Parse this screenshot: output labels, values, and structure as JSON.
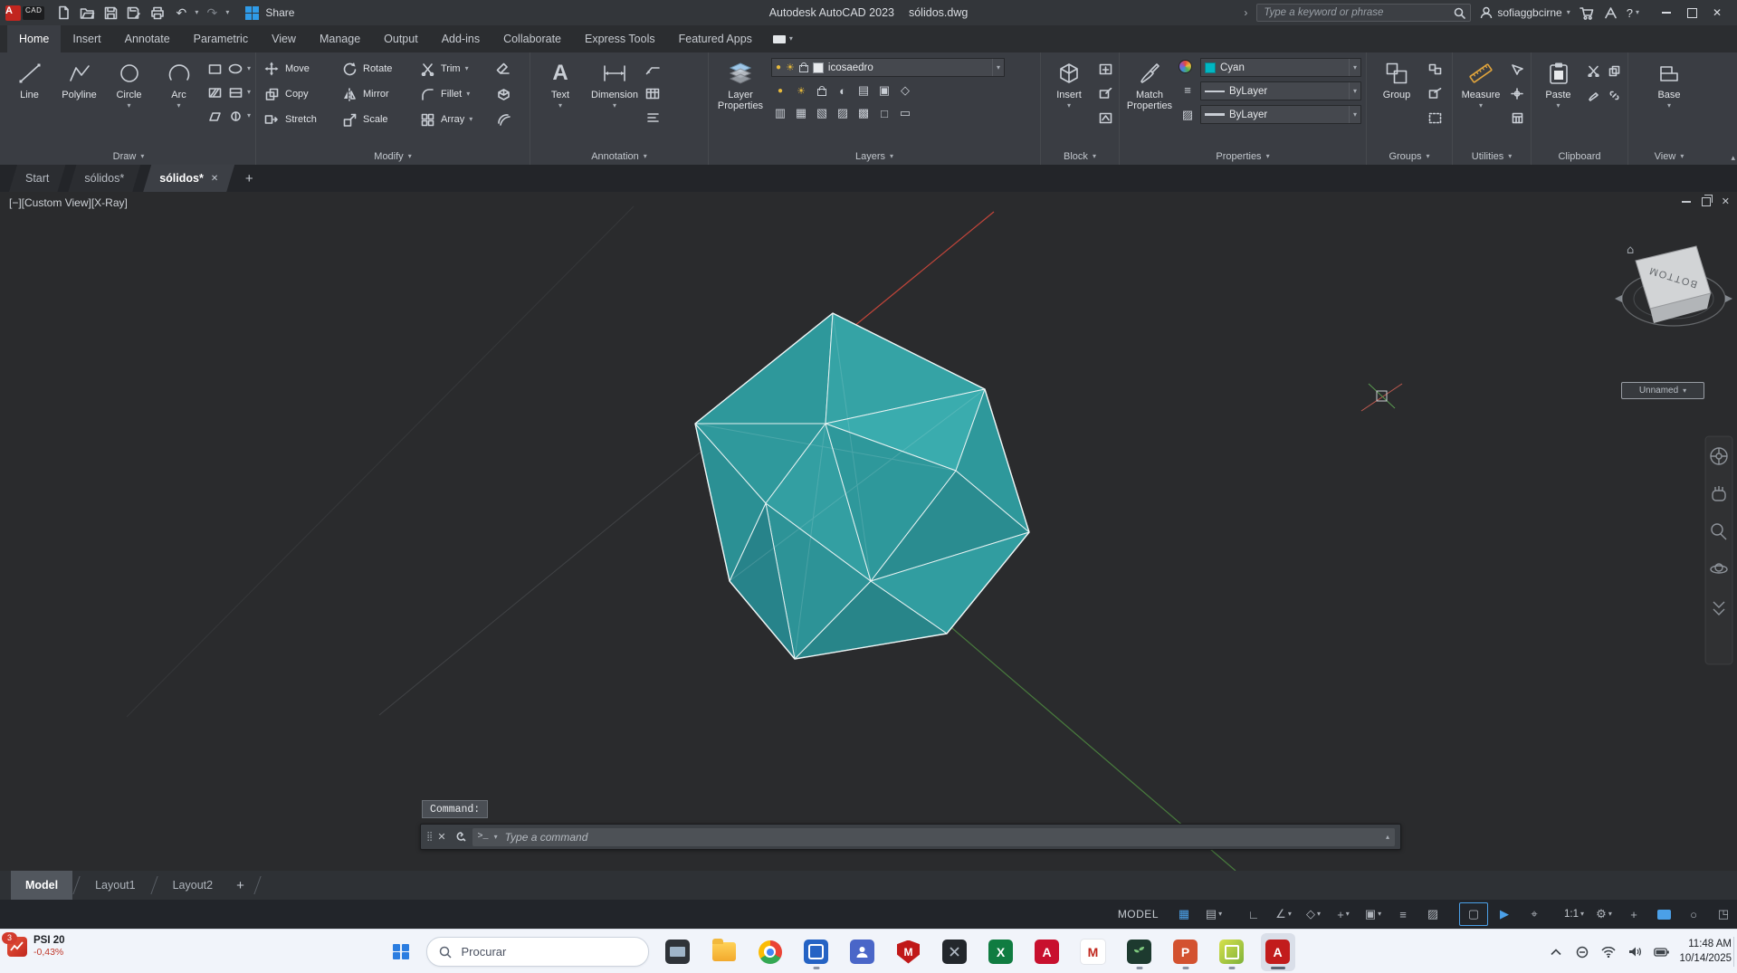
{
  "window": {
    "app_name": "Autodesk AutoCAD 2023",
    "doc_name": "sólidos.dwg",
    "share_label": "Share",
    "search_placeholder": "Type a keyword or phrase",
    "user_name": "sofiaggbcirne",
    "help_label": "?",
    "logo_a": "A",
    "logo_cad": "CAD"
  },
  "glyphs": {
    "down": "▾",
    "close": "✕",
    "plus": "+",
    "undo": "↶",
    "redo": "↷",
    "grip": "⣿",
    "caret_up": "▴",
    "chev_right": "›",
    "home": "⌂",
    "asterisk_a": "A"
  },
  "ribbon": {
    "tabs": [
      "Home",
      "Insert",
      "Annotate",
      "Parametric",
      "View",
      "Manage",
      "Output",
      "Add-ins",
      "Collaborate",
      "Express Tools",
      "Featured Apps"
    ],
    "active_tab": "Home",
    "draw": {
      "label": "Draw",
      "line": "Line",
      "polyline": "Polyline",
      "circle": "Circle",
      "arc": "Arc"
    },
    "modify": {
      "label": "Modify",
      "move": "Move",
      "rotate": "Rotate",
      "trim": "Trim",
      "copy": "Copy",
      "mirror": "Mirror",
      "fillet": "Fillet",
      "stretch": "Stretch",
      "scale": "Scale",
      "array": "Array"
    },
    "annotation": {
      "label": "Annotation",
      "text": "Text",
      "dimension": "Dimension"
    },
    "layers": {
      "label": "Layers",
      "main": "Layer Properties",
      "layer_name": "icosaedro"
    },
    "block": {
      "label": "Block",
      "main": "Insert"
    },
    "properties": {
      "label": "Properties",
      "main": "Match Properties",
      "color": "Cyan",
      "linetype": "ByLayer",
      "lineweight": "ByLayer"
    },
    "groups": {
      "label": "Groups",
      "main": "Group"
    },
    "utilities": {
      "label": "Utilities",
      "main": "Measure"
    },
    "clipboard": {
      "label": "Clipboard",
      "main": "Paste"
    },
    "view": {
      "label": "View",
      "main": "Base"
    }
  },
  "file_tabs": {
    "start": "Start",
    "tab1": "sólidos*",
    "tab2": "sólidos*"
  },
  "viewport": {
    "controls_label": "[−][Custom View][X-Ray]",
    "viewcube_face": "BOTTOM",
    "view_name": "Unnamed",
    "command_echo": "Command:",
    "command_prompt_icon": ">_",
    "command_placeholder": "Type a command"
  },
  "layout_tabs": {
    "model": "Model",
    "layout1": "Layout1",
    "layout2": "Layout2"
  },
  "status_bar": {
    "model_label": "MODEL",
    "scale_label": "1:1"
  },
  "status_icons": {
    "grid": "▦",
    "snap": "▤",
    "ortho": "∟",
    "polar": "∠",
    "isodraft": "◇",
    "otrack": "+",
    "osnap": "▣",
    "lineweight": "≡",
    "transparency": "▨",
    "selection": "▢",
    "cycling": "▶",
    "dynamic_ucs": "⌖",
    "gear": "⚙",
    "annotation_add": "+",
    "isolate": "○",
    "clean_screen": "◳"
  },
  "taskbar": {
    "widget": {
      "badge": "3",
      "index_name": "PSI 20",
      "change": "-0,43%"
    },
    "search_placeholder": "Procurar",
    "clock": {
      "time": "11:48 AM",
      "date": "10/14/2025"
    }
  },
  "icon_glyphs": {
    "mcafee": "M",
    "excel": "X",
    "powerpoint": "P",
    "red_a": "A",
    "red_m": "M",
    "autocad_letter": "A"
  },
  "colors": {
    "teal_solid": "#2e989b",
    "cyan_swatch": "#00b7c3",
    "axis_red": "#c94436",
    "axis_green": "#6f9e3d",
    "active_blue": "#4ba0e8"
  }
}
